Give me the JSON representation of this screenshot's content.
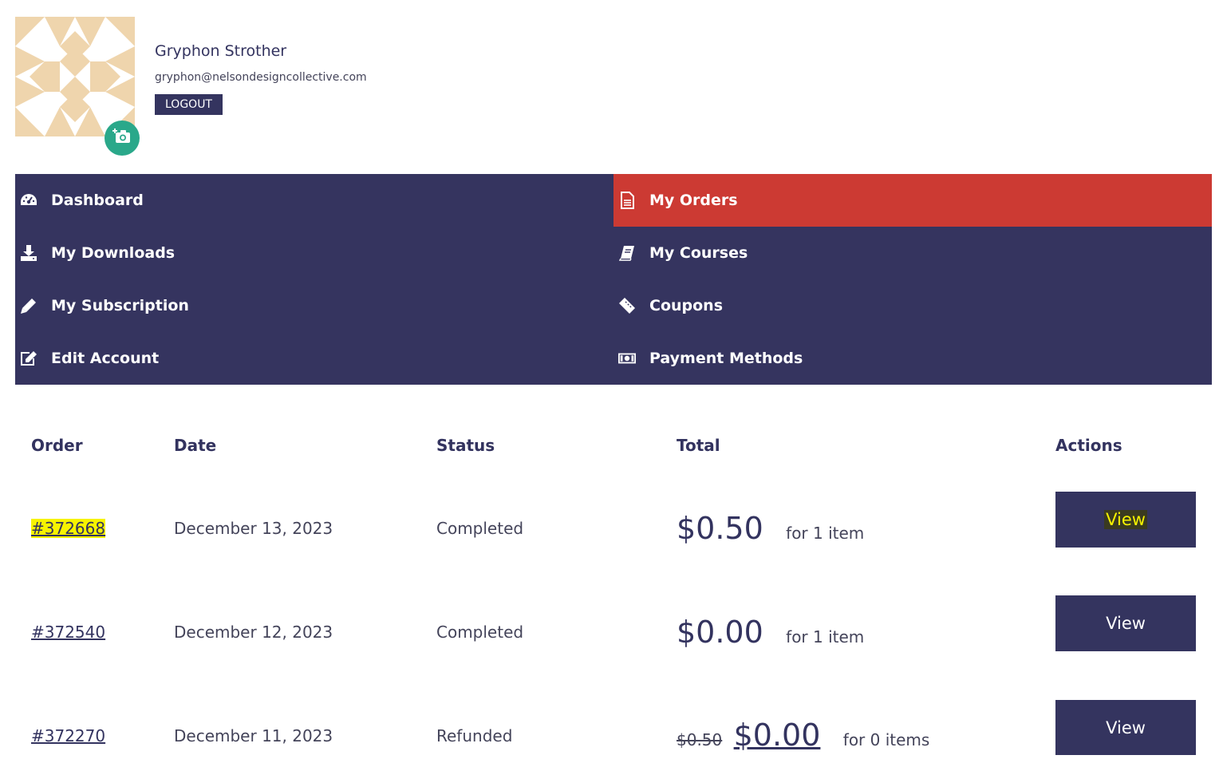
{
  "profile": {
    "name": "Gryphon Strother",
    "email": "gryphon@nelsondesigncollective.com",
    "logout_label": "LOGOUT",
    "avatar_upload_icon": "camera-plus-icon"
  },
  "nav": {
    "items": [
      {
        "label": "Dashboard",
        "icon": "dashboard-icon",
        "active": false
      },
      {
        "label": "My Orders",
        "icon": "document-icon",
        "active": true
      },
      {
        "label": "My Downloads",
        "icon": "download-icon",
        "active": false
      },
      {
        "label": "My Courses",
        "icon": "book-icon",
        "active": false
      },
      {
        "label": "My Subscription",
        "icon": "pencil-icon",
        "active": false
      },
      {
        "label": "Coupons",
        "icon": "ticket-icon",
        "active": false
      },
      {
        "label": "Edit Account",
        "icon": "edit-icon",
        "active": false
      },
      {
        "label": "Payment Methods",
        "icon": "money-icon",
        "active": false
      }
    ],
    "colors": {
      "background": "#35345f",
      "active": "#cc3a33"
    }
  },
  "orders": {
    "columns": [
      "Order",
      "Date",
      "Status",
      "Total",
      "Actions"
    ],
    "rows": [
      {
        "order": "#372668",
        "date": "December 13, 2023",
        "status": "Completed",
        "old_total": "",
        "total": "$0.50",
        "items": "for 1 item",
        "action": "View"
      },
      {
        "order": "#372540",
        "date": "December 12, 2023",
        "status": "Completed",
        "old_total": "",
        "total": "$0.00",
        "items": "for 1 item",
        "action": "View"
      },
      {
        "order": "#372270",
        "date": "December 11, 2023",
        "status": "Refunded",
        "old_total": "$0.50",
        "total": "$0.00",
        "items": "for 0 items",
        "action": "View"
      }
    ]
  }
}
